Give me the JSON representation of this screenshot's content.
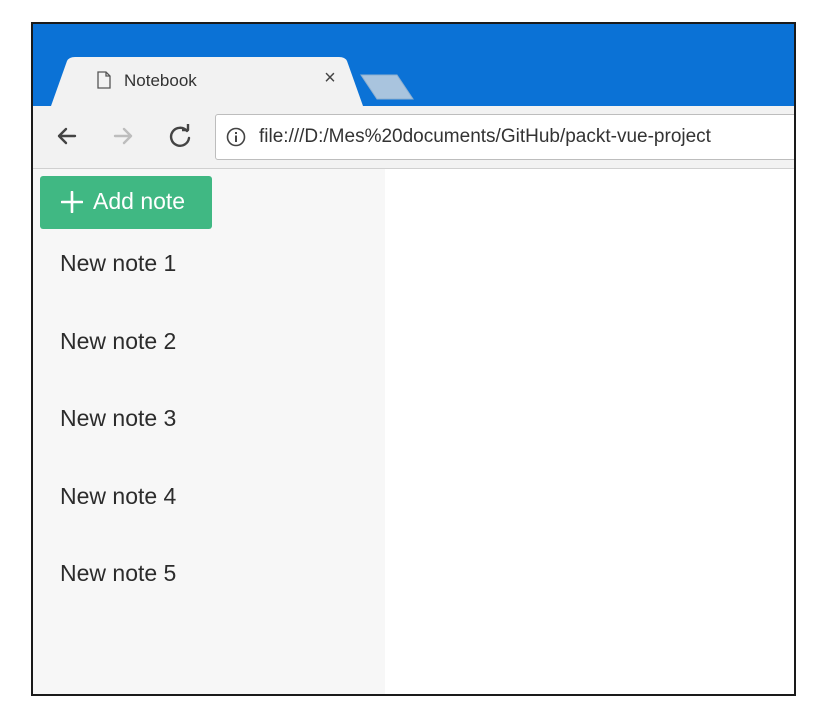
{
  "browser": {
    "tab": {
      "title": "Notebook",
      "close_glyph": "×",
      "icon": "page-icon"
    },
    "new_tab": {
      "icon": "new-tab-icon"
    },
    "toolbar": {
      "back_icon": "arrow-left-icon",
      "forward_icon": "arrow-right-icon",
      "reload_icon": "reload-icon",
      "info_icon": "info-icon",
      "url": "file:///D:/Mes%20documents/GitHub/packt-vue-project"
    },
    "colors": {
      "tabstrip": "#0b72d6",
      "tab_active": "#f2f2f2",
      "new_tab": "#a9c4de"
    }
  },
  "app": {
    "add_note": {
      "label": "Add note",
      "icon": "plus-icon",
      "color": "#40b883"
    },
    "notes": [
      {
        "title": "New note 1"
      },
      {
        "title": "New note 2"
      },
      {
        "title": "New note 3"
      },
      {
        "title": "New note 4"
      },
      {
        "title": "New note 5"
      }
    ]
  }
}
